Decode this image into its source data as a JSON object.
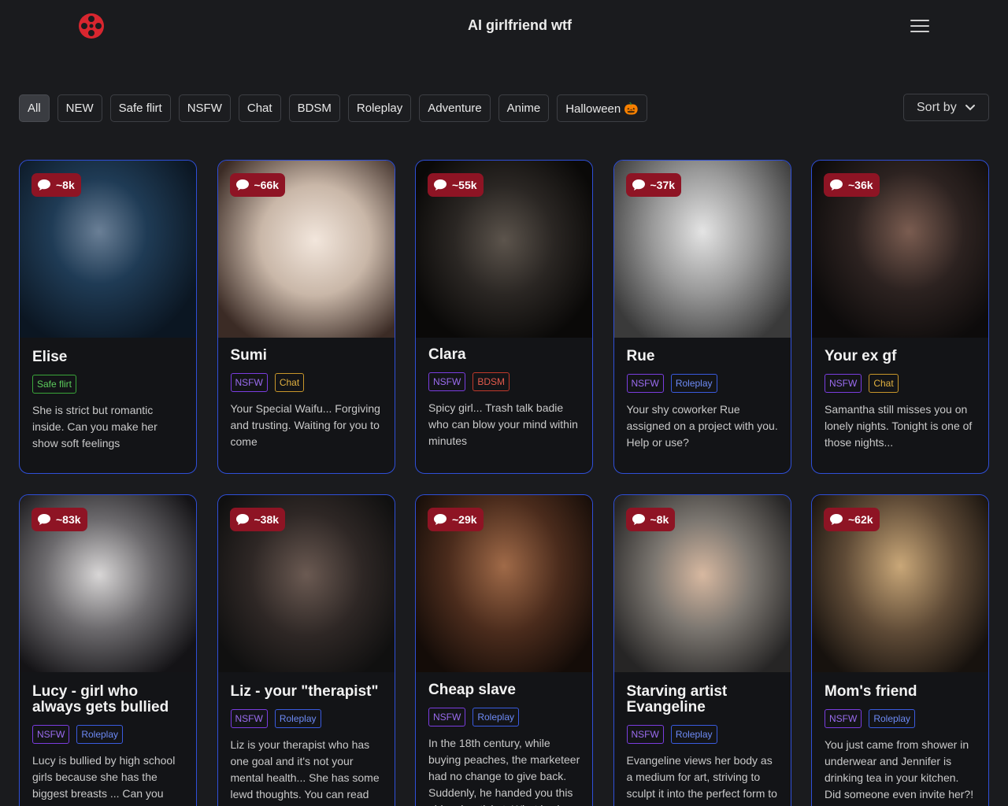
{
  "header": {
    "title": "AI girlfriend wtf"
  },
  "filters": [
    {
      "label": "All",
      "active": true
    },
    {
      "label": "NEW"
    },
    {
      "label": "Safe flirt"
    },
    {
      "label": "NSFW"
    },
    {
      "label": "Chat"
    },
    {
      "label": "BDSM"
    },
    {
      "label": "Roleplay"
    },
    {
      "label": "Adventure"
    },
    {
      "label": "Anime"
    },
    {
      "label": "Halloween 🎃"
    }
  ],
  "sort": {
    "label": "Sort by"
  },
  "colors": {
    "accent_border": "#2f4fd8",
    "badge": "#8e1424",
    "background": "#1a1b1e"
  },
  "cards": [
    {
      "name": "Elise",
      "count": "~8k",
      "tags": [
        {
          "label": "Safe flirt",
          "kind": "safe"
        }
      ],
      "description": "She is strict but romantic inside. Can you make her show soft feelings"
    },
    {
      "name": "Sumi",
      "count": "~66k",
      "tags": [
        {
          "label": "NSFW",
          "kind": "nsfw"
        },
        {
          "label": "Chat",
          "kind": "chat"
        }
      ],
      "description": "Your Special Waifu... Forgiving and trusting. Waiting for you to come"
    },
    {
      "name": "Clara",
      "count": "~55k",
      "tags": [
        {
          "label": "NSFW",
          "kind": "nsfw"
        },
        {
          "label": "BDSM",
          "kind": "bdsm"
        }
      ],
      "description": "Spicy girl... Trash talk badie who can blow your mind within minutes"
    },
    {
      "name": "Rue",
      "count": "~37k",
      "tags": [
        {
          "label": "NSFW",
          "kind": "nsfw"
        },
        {
          "label": "Roleplay",
          "kind": "roleplay"
        }
      ],
      "description": "Your shy coworker Rue assigned on a project with you. Help or use?"
    },
    {
      "name": "Your ex gf",
      "count": "~36k",
      "tags": [
        {
          "label": "NSFW",
          "kind": "nsfw"
        },
        {
          "label": "Chat",
          "kind": "chat"
        }
      ],
      "description": "Samantha still misses you on lonely nights. Tonight is one of those nights..."
    },
    {
      "name": "Lucy - girl who always gets bullied",
      "count": "~83k",
      "tags": [
        {
          "label": "NSFW",
          "kind": "nsfw"
        },
        {
          "label": "Roleplay",
          "kind": "roleplay"
        }
      ],
      "description": "Lucy is bullied by high school girls because she has the biggest breasts ... Can you comfort her?"
    },
    {
      "name": "Liz - your \"therapist\"",
      "count": "~38k",
      "tags": [
        {
          "label": "NSFW",
          "kind": "nsfw"
        },
        {
          "label": "Roleplay",
          "kind": "roleplay"
        }
      ],
      "description": "Liz is your therapist who has one goal and it's not your mental health... She has some lewd thoughts. You can read them..."
    },
    {
      "name": "Cheap slave",
      "count": "~29k",
      "tags": [
        {
          "label": "NSFW",
          "kind": "nsfw"
        },
        {
          "label": "Roleplay",
          "kind": "roleplay"
        }
      ],
      "description": "In the 18th century, while buying peaches, the marketeer had no change to give back. Suddenly, he handed you this girl as her ticket. What is she"
    },
    {
      "name": "Starving artist Evangeline",
      "count": "~8k",
      "tags": [
        {
          "label": "NSFW",
          "kind": "nsfw"
        },
        {
          "label": "Roleplay",
          "kind": "roleplay"
        }
      ],
      "description": "Evangeline views her body as a medium for art, striving to sculpt it into the perfect form to express her feminine sensuality"
    },
    {
      "name": "Mom's friend",
      "count": "~62k",
      "tags": [
        {
          "label": "NSFW",
          "kind": "nsfw"
        },
        {
          "label": "Roleplay",
          "kind": "roleplay"
        }
      ],
      "description": "You just came from shower in underwear and Jennifer is drinking tea in your kitchen. Did someone even invite her?!"
    }
  ]
}
